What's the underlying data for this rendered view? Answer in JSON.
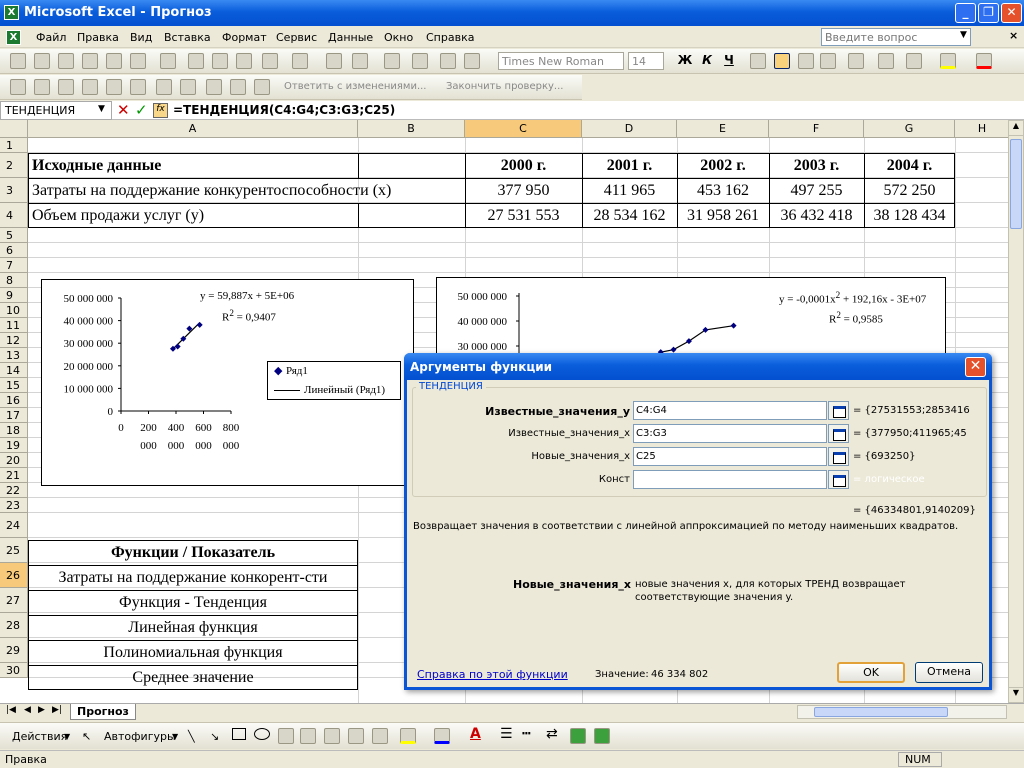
{
  "window": {
    "title": "Microsoft Excel - Прогноз"
  },
  "menu": [
    "Файл",
    "Правка",
    "Вид",
    "Вставка",
    "Формат",
    "Сервис",
    "Данные",
    "Окно",
    "Справка"
  ],
  "ask_placeholder": "Введите вопрос",
  "font": {
    "name": "Times New Roman",
    "size": "14"
  },
  "review": {
    "reply": "Ответить с изменениями...",
    "end": "Закончить проверку..."
  },
  "formula_bar": {
    "name_box": "ТЕНДЕНЦИЯ",
    "formula": "=ТЕНДЕНЦИЯ(C4:G4;C3:G3;C25)"
  },
  "columns": [
    "A",
    "B",
    "C",
    "D",
    "E",
    "F",
    "G",
    "H"
  ],
  "rows": [
    "1",
    "2",
    "3",
    "4",
    "5",
    "6",
    "7",
    "8",
    "9",
    "10",
    "11",
    "12",
    "13",
    "14",
    "15",
    "16",
    "17",
    "18",
    "19",
    "20",
    "21",
    "22",
    "23",
    "24",
    "25",
    "26",
    "27",
    "28",
    "29",
    "30"
  ],
  "table": {
    "r2": {
      "a": "Исходные данные",
      "c": "2000 г.",
      "d": "2001 г.",
      "e": "2002 г.",
      "f": "2003 г.",
      "g": "2004 г."
    },
    "r3": {
      "a": "Затраты на поддержание конкурентоспособности (x)",
      "c": "377 950",
      "d": "411 965",
      "e": "453 162",
      "f": "497 255",
      "g": "572 250"
    },
    "r4": {
      "a": "Объем продажи услуг (y)",
      "c": "27 531 553",
      "d": "28 534 162",
      "e": "31 958 261",
      "f": "36 432 418",
      "g": "38 128 434"
    }
  },
  "functions": [
    "Функции / Показатель",
    "Затраты на поддержание конкорент-сти",
    "Функция - Тенденция",
    "Линейная функция",
    "Полиномиальная функция",
    "Среднее значение"
  ],
  "chart_data": [
    {
      "type": "scatter",
      "x": [
        377950,
        411965,
        453162,
        497255,
        572250
      ],
      "y": [
        27531553,
        28534162,
        31958261,
        36432418,
        38128434
      ],
      "y_ticks": [
        "50 000 000",
        "40 000 000",
        "30 000 000",
        "20 000 000",
        "10 000 000",
        "0"
      ],
      "x_ticks": [
        [
          "0",
          ""
        ],
        [
          "200",
          "000"
        ],
        [
          "400",
          "000"
        ],
        [
          "600",
          "000"
        ],
        [
          "800",
          "000"
        ]
      ],
      "xlim": [
        0,
        800000
      ],
      "ylim": [
        0,
        50000000
      ],
      "equation": "y = 59,887x + 5E+06",
      "r2_label": "R",
      "r2_sup": "2",
      "r2_value": " = 0,9407",
      "legend": {
        "series": "Ряд1",
        "trend": "Линейный (Ряд1)"
      }
    },
    {
      "type": "scatter",
      "x": [
        377950,
        411965,
        453162,
        497255,
        572250
      ],
      "y": [
        27531553,
        28534162,
        31958261,
        36432418,
        38128434
      ],
      "y_ticks": [
        "50 000 000",
        "40 000 000",
        "30 000 000"
      ],
      "equation_pre": "y = -0,0001x",
      "equation_sup": "2",
      "equation_post": " + 192,16x - 3E+07",
      "r2_label": "R",
      "r2_sup": "2",
      "r2_value": " = 0,9585"
    }
  ],
  "dialog": {
    "title": "Аргументы функции",
    "group": "ТЕНДЕНЦИЯ",
    "args": [
      {
        "label": "Известные_значения_y",
        "value": "C4:G4",
        "result": "= {27531553;2853416"
      },
      {
        "label": "Известные_значения_x",
        "value": "C3:G3",
        "result": "= {377950;411965;45"
      },
      {
        "label": "Новые_значения_x",
        "value": "C25",
        "result": "= {693250}"
      },
      {
        "label": "Конст",
        "value": "",
        "result": "= логическое"
      }
    ],
    "total": "= {46334801,9140209}",
    "description": "Возвращает значения в соответствии с линейной аппроксимацией по методу наименьших квадратов.",
    "arg_help_name": "Новые_значения_x",
    "arg_help_text": "новые значения x, для которых ТРЕНД возвращает соответствующие значения y.",
    "help_link": "Справка по этой функции",
    "value_label": "Значение:",
    "value": "46 334 802",
    "ok": "OK",
    "cancel": "Отмена"
  },
  "sheet_tab": "Прогноз",
  "draw": {
    "actions": "Действия",
    "autoshapes": "Автофигуры"
  },
  "status": {
    "left": "Правка",
    "num": "NUM"
  }
}
